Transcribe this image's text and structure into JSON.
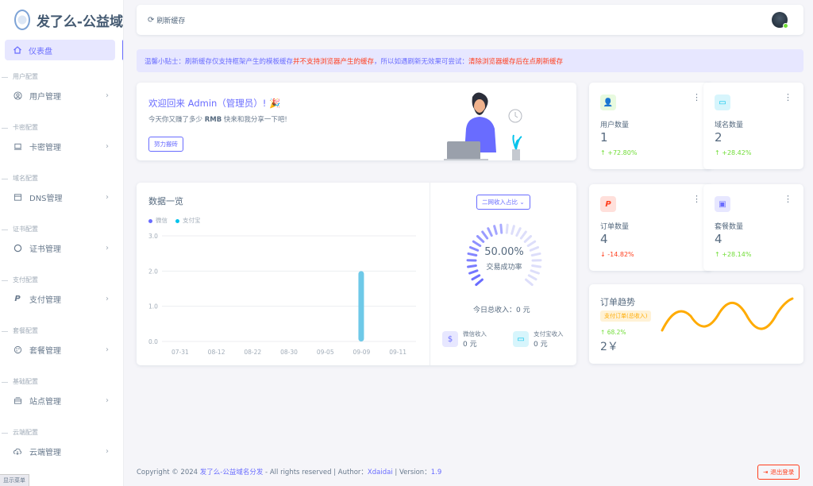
{
  "brand": {
    "name": "发了么-公益域"
  },
  "sidebar": {
    "active": {
      "label": "仪表盘"
    },
    "groups": [
      {
        "header": "用户配置",
        "item": "用户管理"
      },
      {
        "header": "卡密配置",
        "item": "卡密管理"
      },
      {
        "header": "域名配置",
        "item": "DNS管理"
      },
      {
        "header": "证书配置",
        "item": "证书管理"
      },
      {
        "header": "支付配置",
        "item": "支付管理"
      },
      {
        "header": "套餐配置",
        "item": "套餐管理"
      },
      {
        "header": "基础配置",
        "item": "站点管理"
      },
      {
        "header": "云端配置",
        "item": "云端管理"
      }
    ],
    "footer": "显示菜单"
  },
  "topbar": {
    "refresh_label": "刷新缓存"
  },
  "alert": {
    "prefix": "温馨小贴士：刷新缓存仅支持框架产生的模板缓存",
    "middle": "并不支持浏览器产生的缓存",
    "suffix": "，所以如遇刷新无效果可尝试：",
    "tail": "清除浏览器缓存后在点刷新缓存"
  },
  "welcome": {
    "title": "欢迎回来 Admin（管理员）! 🎉",
    "text_before": "今天你又赚了多少 ",
    "text_bold": "RMB",
    "text_after": " 快来和我分享一下吧!",
    "button": "努力搬砖"
  },
  "stats": {
    "users": {
      "label": "用户数量",
      "value": "1",
      "change": "+72.80%"
    },
    "domains": {
      "label": "域名数量",
      "value": "2",
      "change": "+28.42%"
    },
    "orders": {
      "label": "订单数量",
      "value": "4",
      "change": "-14.82%"
    },
    "packages": {
      "label": "套餐数量",
      "value": "4",
      "change": "+28.14%"
    }
  },
  "overview": {
    "title": "数据一览",
    "select": "二网收入占比",
    "gauge_pct": "50.00%",
    "gauge_label": "交易成功率",
    "today": "今日总收入：0 元",
    "wechat": {
      "label": "微信收入",
      "value": "0 元"
    },
    "alipay": {
      "label": "支付宝收入",
      "value": "0 元"
    }
  },
  "chart_data": {
    "type": "bar",
    "categories": [
      "07-31",
      "08-12",
      "08-22",
      "08-30",
      "09-05",
      "09-09",
      "09-11"
    ],
    "series": [
      {
        "name": "微信",
        "color": "#696cff",
        "values": [
          0,
          0,
          0,
          0,
          0,
          0,
          0
        ]
      },
      {
        "name": "支付宝",
        "color": "#03c3ec",
        "values": [
          0,
          0,
          0,
          0,
          0,
          2,
          0
        ]
      }
    ],
    "yticks": [
      "0.0",
      "1.0",
      "2.0",
      "3.0"
    ],
    "ylim": [
      0,
      3
    ],
    "title": "数据一览"
  },
  "trend": {
    "title": "订单趋势",
    "badge": "支付订单(总收入)",
    "pct": "68.2%",
    "value": "2￥"
  },
  "footer": {
    "prefix": "Copyright © 2024 ",
    "site": "发了么-公益域名分发",
    "middle": " - All rights reserved | Author：",
    "author": "Xdaidai",
    "version_label": " | Version：",
    "version": "1.9",
    "logout": "退出登录"
  },
  "colors": {
    "primary": "#696cff",
    "success": "#71dd37",
    "danger": "#ff3e1d",
    "info": "#03c3ec",
    "warning": "#ffab00"
  }
}
